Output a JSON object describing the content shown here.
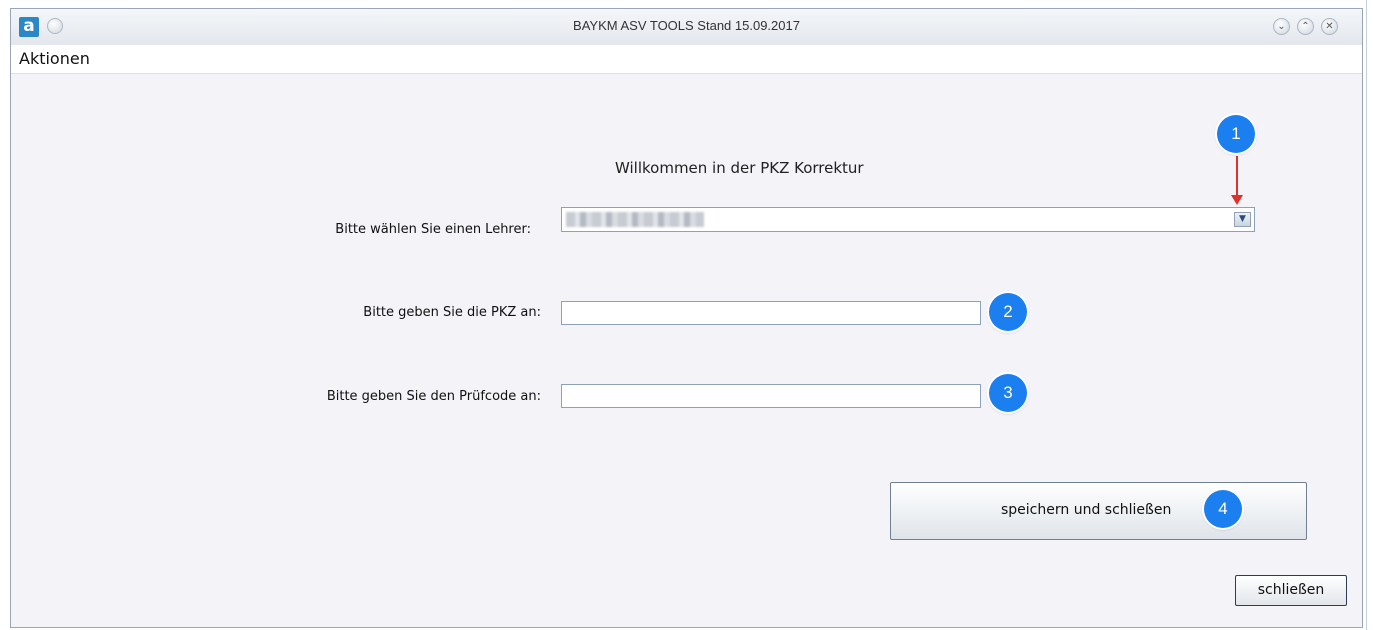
{
  "window": {
    "title": "BAYKM ASV TOOLS Stand 15.09.2017",
    "app_icon_letter": "a",
    "controls": [
      "⌄",
      "⌃",
      "✕"
    ]
  },
  "menu": {
    "items": [
      {
        "label": "Aktionen"
      }
    ]
  },
  "main": {
    "heading": "Willkommen in der PKZ Korrektur",
    "teacher_label": "Bitte wählen Sie einen Lehrer:",
    "teacher_select_value": "",
    "pkz_label": "Bitte geben Sie die PKZ an:",
    "pkz_value": "",
    "pruefcode_label": "Bitte geben Sie den Prüfcode an:",
    "pruefcode_value": ""
  },
  "buttons": {
    "save_close_label": "speichern und schließen",
    "close_label": "schließen"
  },
  "annotations": {
    "badges": [
      "1",
      "2",
      "3",
      "4"
    ],
    "badge_color": "#1b7ff0",
    "arrow_color": "#e0302a"
  }
}
